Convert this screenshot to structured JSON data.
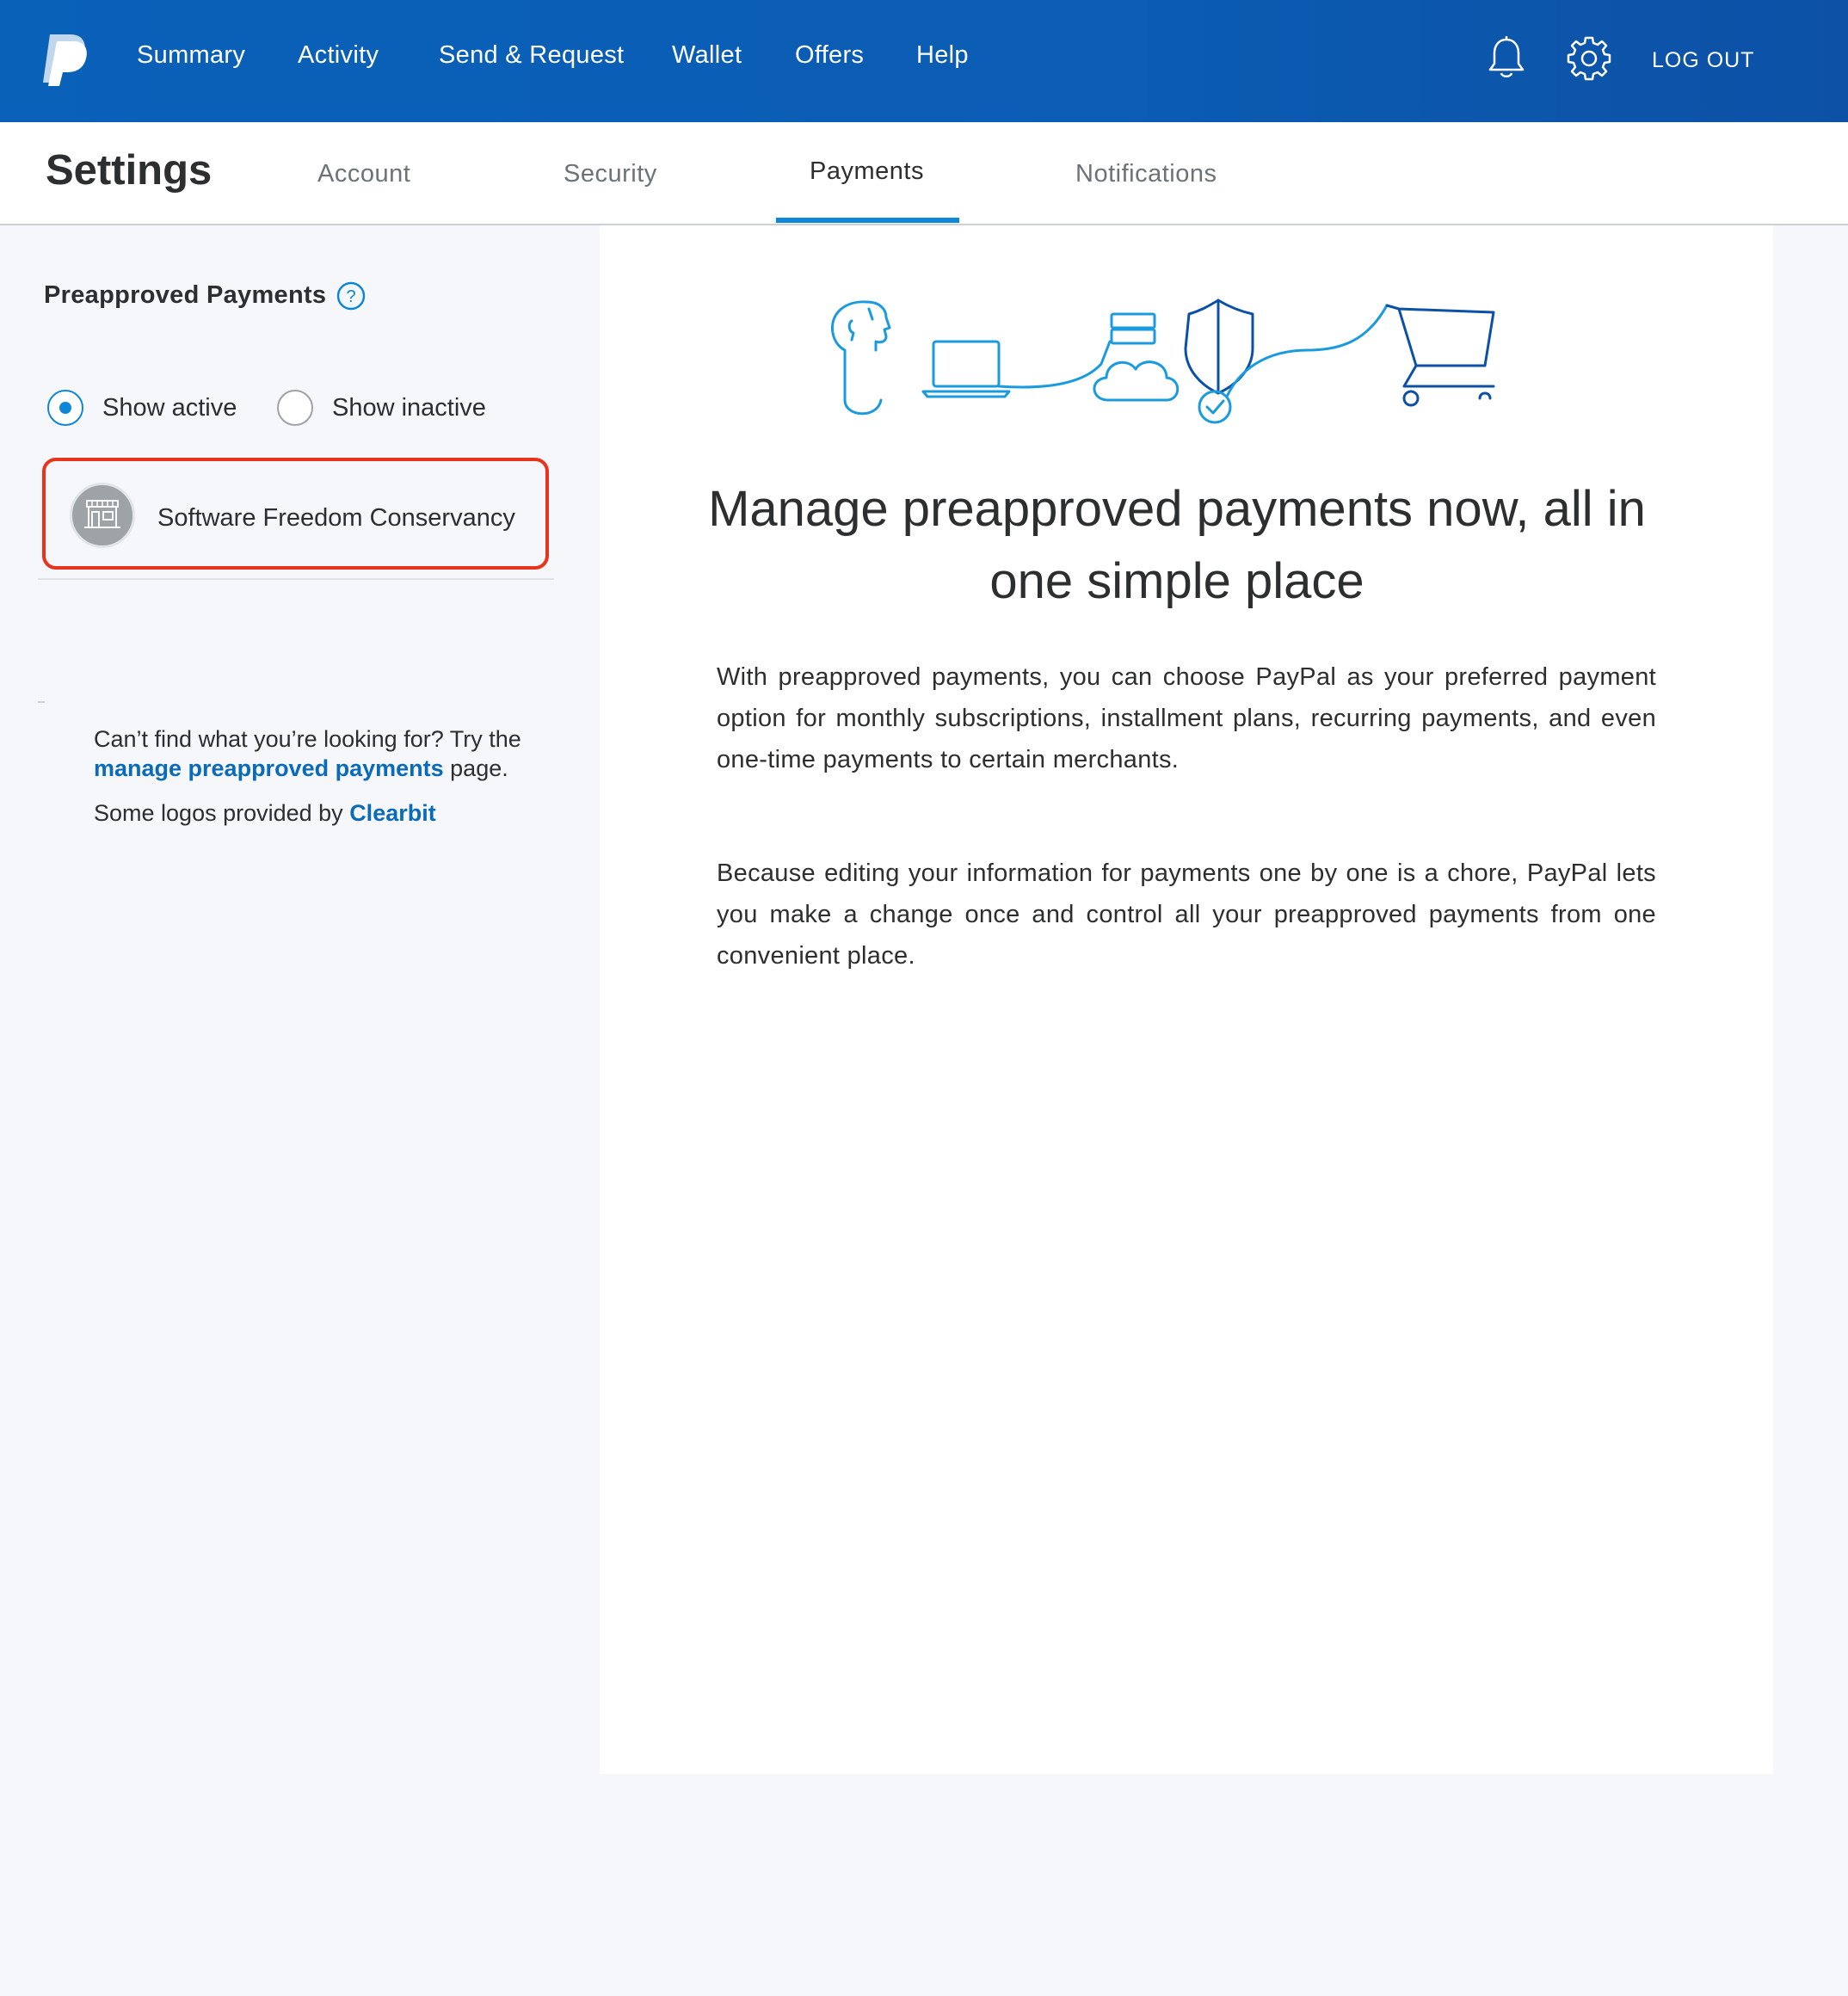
{
  "brand": {
    "primary": "#0b5cb3",
    "accent": "#0d87d8",
    "link": "#0b6bb8",
    "highlight": "#e8341c"
  },
  "topnav": {
    "items": [
      "Summary",
      "Activity",
      "Send & Request",
      "Wallet",
      "Offers",
      "Help"
    ],
    "logout": "LOG OUT",
    "icons": [
      "paypal-logo-icon",
      "bell-icon",
      "gear-icon"
    ]
  },
  "settings": {
    "title": "Settings",
    "tabs": [
      {
        "label": "Account",
        "active": false
      },
      {
        "label": "Security",
        "active": false
      },
      {
        "label": "Payments",
        "active": true
      },
      {
        "label": "Notifications",
        "active": false
      }
    ]
  },
  "sidebar": {
    "heading": "Preapproved Payments",
    "filters": [
      {
        "label": "Show active",
        "checked": true
      },
      {
        "label": "Show inactive",
        "checked": false
      }
    ],
    "merchants": [
      {
        "name": "Software Freedom Conservancy",
        "icon": "storefront-icon"
      }
    ],
    "help_prefix": "Can’t find what you’re looking for? Try the",
    "help_link": "manage preapproved payments",
    "help_suffix": "page.",
    "logos_prefix": "Some logos provided by",
    "logos_link": "Clearbit"
  },
  "main": {
    "title": "Manage preapproved payments now, all in one simple place",
    "paragraph1": "With preapproved payments, you can choose PayPal as your preferred payment option for monthly subscriptions, installment plans, recurring payments, and even one-time payments to certain merchants.",
    "paragraph2": "Because editing your information for payments one by one is a chore, PayPal lets you make a change once and control all your preapproved payments from one convenient place."
  }
}
